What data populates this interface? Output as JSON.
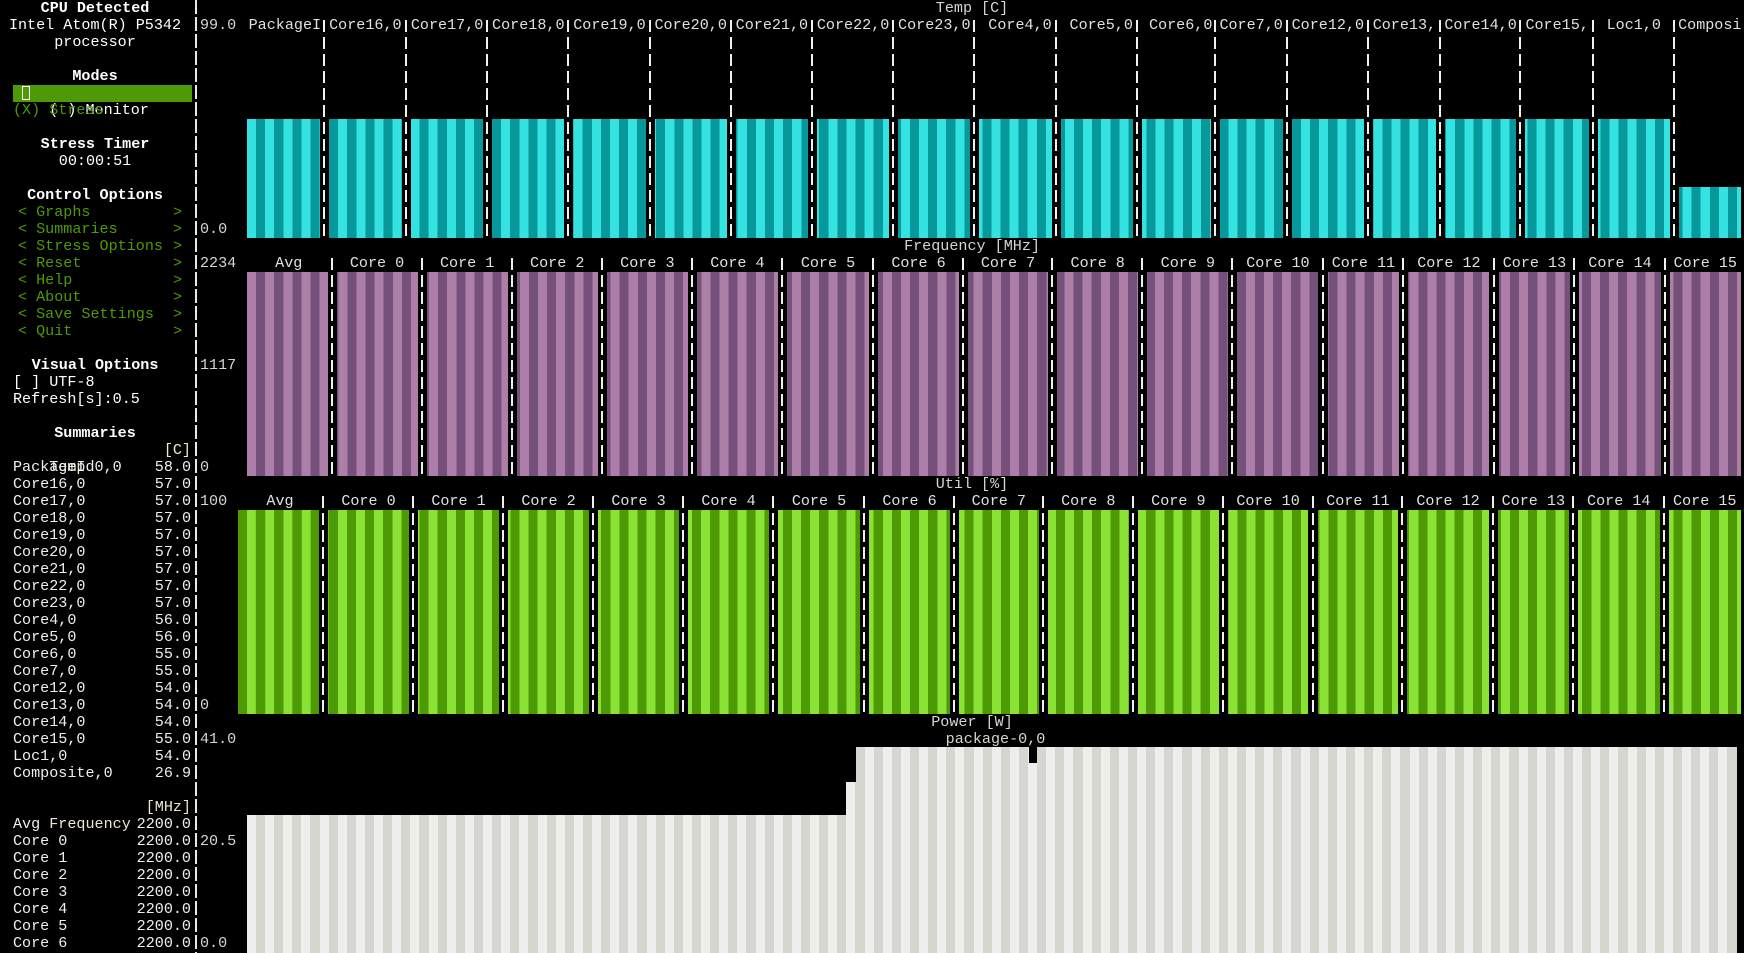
{
  "sidebar": {
    "cpu_title": "CPU Detected",
    "cpu_name_1": "Intel Atom(R) P5342",
    "cpu_name_2": "processor",
    "modes_title": "Modes",
    "modes": [
      {
        "marker": "( )",
        "label": "Monitor"
      },
      {
        "marker": "(X)",
        "label": "Stress"
      }
    ],
    "stress_timer_title": "Stress Timer",
    "stress_timer_value": "00:00:51",
    "control_title": "Control Options",
    "controls": [
      {
        "label": "Graphs"
      },
      {
        "label": "Summaries"
      },
      {
        "label": "Stress Options"
      },
      {
        "label": "Reset"
      },
      {
        "label": "Help"
      },
      {
        "label": "About"
      },
      {
        "label": "Save Settings"
      },
      {
        "label": "Quit"
      }
    ],
    "control_left": "<",
    "control_right": ">",
    "visual_title": "Visual Options",
    "utf8_checkbox": "[ ] UTF-8",
    "refresh": "Refresh[s]:0.5",
    "summaries_title": "Summaries",
    "temp_summary": {
      "label": "Temp",
      "unit": "[C]",
      "rows": [
        {
          "name": "PackageId0,0",
          "value": "58.0"
        },
        {
          "name": "Core16,0",
          "value": "57.0"
        },
        {
          "name": "Core17,0",
          "value": "57.0"
        },
        {
          "name": "Core18,0",
          "value": "57.0"
        },
        {
          "name": "Core19,0",
          "value": "57.0"
        },
        {
          "name": "Core20,0",
          "value": "57.0"
        },
        {
          "name": "Core21,0",
          "value": "57.0"
        },
        {
          "name": "Core22,0",
          "value": "57.0"
        },
        {
          "name": "Core23,0",
          "value": "57.0"
        },
        {
          "name": "Core4,0",
          "value": "56.0"
        },
        {
          "name": "Core5,0",
          "value": "56.0"
        },
        {
          "name": "Core6,0",
          "value": "55.0"
        },
        {
          "name": "Core7,0",
          "value": "55.0"
        },
        {
          "name": "Core12,0",
          "value": "54.0"
        },
        {
          "name": "Core13,0",
          "value": "54.0"
        },
        {
          "name": "Core14,0",
          "value": "54.0"
        },
        {
          "name": "Core15,0",
          "value": "55.0"
        },
        {
          "name": "Loc1,0",
          "value": "54.0"
        },
        {
          "name": "Composite,0",
          "value": "26.9"
        }
      ]
    },
    "freq_summary": {
      "label": "Frequency",
      "unit": "[MHz]",
      "rows": [
        {
          "name": "Avg",
          "value": "2200.0"
        },
        {
          "name": "Core 0",
          "value": "2200.0"
        },
        {
          "name": "Core 1",
          "value": "2200.0"
        },
        {
          "name": "Core 2",
          "value": "2200.0"
        },
        {
          "name": "Core 3",
          "value": "2200.0"
        },
        {
          "name": "Core 4",
          "value": "2200.0"
        },
        {
          "name": "Core 5",
          "value": "2200.0"
        },
        {
          "name": "Core 6",
          "value": "2200.0"
        }
      ]
    }
  },
  "colors": {
    "accent_green": "#4e9a06",
    "temp": [
      "#34e2e2",
      "#06989a"
    ],
    "freq": [
      "#ad7fa8",
      "#75507b"
    ],
    "util": [
      "#8ae234",
      "#4e9a06"
    ],
    "power": [
      "#eeeeec",
      "#d3d7cf"
    ]
  },
  "chart_data": [
    {
      "type": "bar",
      "title": "Temp [C]",
      "ylim": [
        0,
        99.0
      ],
      "ticks": [
        "99.0",
        "0.0"
      ],
      "categories": [
        "PackageI",
        "Core16,0",
        "Core17,0",
        "Core18,0",
        "Core19,0",
        "Core20,0",
        "Core21,0",
        "Core22,0",
        "Core23,0",
        " Core4,0",
        " Core5,0",
        " Core6,0",
        "Core7,0",
        "Core12,0",
        "Core13,",
        "Core14,0",
        "Core15,",
        " Loc1,0 ",
        "Composi"
      ],
      "values": [
        58,
        57,
        57,
        57,
        57,
        57,
        57,
        57,
        57,
        56,
        56,
        55,
        55,
        54,
        54,
        54,
        55,
        54,
        26.9
      ]
    },
    {
      "type": "bar",
      "title": "Frequency [MHz]",
      "ylim": [
        0,
        2234
      ],
      "ticks": [
        "2234",
        "1117",
        "0"
      ],
      "categories": [
        "Avg",
        "Core 0",
        "Core 1",
        "Core 2",
        "Core 3",
        "Core 4",
        "Core 5",
        "Core 6",
        "Core 7",
        "Core 8",
        "Core 9",
        "Core 10",
        "Core 11",
        "Core 12",
        "Core 13",
        "Core 14",
        "Core 15"
      ],
      "values": [
        2200,
        2200,
        2200,
        2200,
        2200,
        2200,
        2200,
        2200,
        2200,
        2200,
        2200,
        2200,
        2200,
        2200,
        2200,
        2200,
        2200
      ]
    },
    {
      "type": "bar",
      "title": "Util [%]",
      "ylim": [
        0,
        100
      ],
      "ticks": [
        "100",
        "0"
      ],
      "categories": [
        "Avg",
        "Core 0",
        "Core 1",
        "Core 2",
        "Core 3",
        "Core 4",
        "Core 5",
        "Core 6",
        "Core 7",
        "Core 8",
        "Core 9",
        "Core 10",
        "Core 11",
        "Core 12",
        "Core 13",
        "Core 14",
        "Core 15"
      ],
      "values": [
        96,
        96,
        96,
        96,
        96,
        96,
        96,
        96,
        96,
        96,
        96,
        96,
        96,
        96,
        96,
        96,
        96
      ]
    },
    {
      "type": "area",
      "title": "Power [W]",
      "ylim": [
        0,
        41.0
      ],
      "ticks": [
        "41.0",
        "20.5",
        "0.0"
      ],
      "series": [
        {
          "name": "package-0,0",
          "values_rle": [
            [
              66,
              25.6
            ],
            [
              1,
              31.7
            ],
            [
              19,
              38.2
            ],
            [
              1,
              35.2
            ],
            [
              77,
              38.2
            ]
          ]
        }
      ]
    }
  ]
}
